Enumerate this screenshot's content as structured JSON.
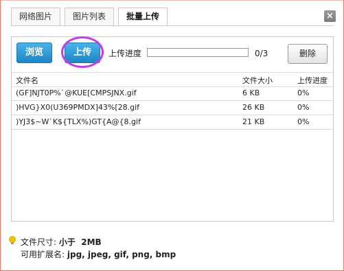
{
  "tabs": [
    {
      "label": "网络图片",
      "active": false
    },
    {
      "label": "图片列表",
      "active": false
    },
    {
      "label": "批量上传",
      "active": true
    }
  ],
  "close_label": "×",
  "toolbar": {
    "browse_label": "浏览",
    "upload_label": "上传",
    "progress_label": "上传进度",
    "progress_count": "0/3",
    "progress_fraction": 0,
    "delete_label": "删除"
  },
  "table": {
    "headers": [
      "文件名",
      "文件大小",
      "上传进度"
    ],
    "rows": [
      {
        "name": "(GF]NJT0P%`@KUE[CMPSJNX.gif",
        "size": "6 KB",
        "progress": "0%"
      },
      {
        "name": ")HVG}X0(U369PMDX]43%[28.gif",
        "size": "26 KB",
        "progress": "0%"
      },
      {
        "name": ")YJ3$~W`K${TLX%)GT{A@{8.gif",
        "size": "21 KB",
        "progress": "0%"
      }
    ]
  },
  "info": {
    "size_label": "文件尺寸:",
    "size_value": "小于  2MB",
    "ext_label": "可用扩展名:",
    "ext_value": "jpg, jpeg, gif, png, bmp"
  },
  "colors": {
    "accent_blue": "#1b86c6",
    "highlight_ring": "#c23de6",
    "frame_border": "#e07a6a"
  }
}
